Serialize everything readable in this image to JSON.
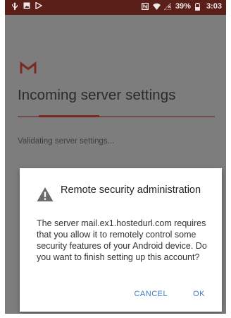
{
  "status_bar": {
    "battery": "39%",
    "time": "3:03",
    "icons": [
      "usb-icon",
      "image-notification-icon",
      "play-store-icon",
      "nfc-icon",
      "wifi-icon",
      "no-signal-icon",
      "battery-icon"
    ]
  },
  "app": {
    "logo": "gmail-logo",
    "title": "Incoming server settings",
    "status": "Validating server settings..."
  },
  "dialog": {
    "icon": "warning-icon",
    "title": "Remote security administration",
    "message": "The server mail.ex1.hostedurl.com requires that you allow it to remotely control some security features of your Android device. Do you want to finish setting up this account?",
    "cancel_label": "CANCEL",
    "ok_label": "OK"
  },
  "colors": {
    "status_bar": "#5a1f19",
    "accent": "#3c7ac4",
    "scrim_background": "#7d7d7d",
    "gmail_red": "#7a2a22"
  }
}
